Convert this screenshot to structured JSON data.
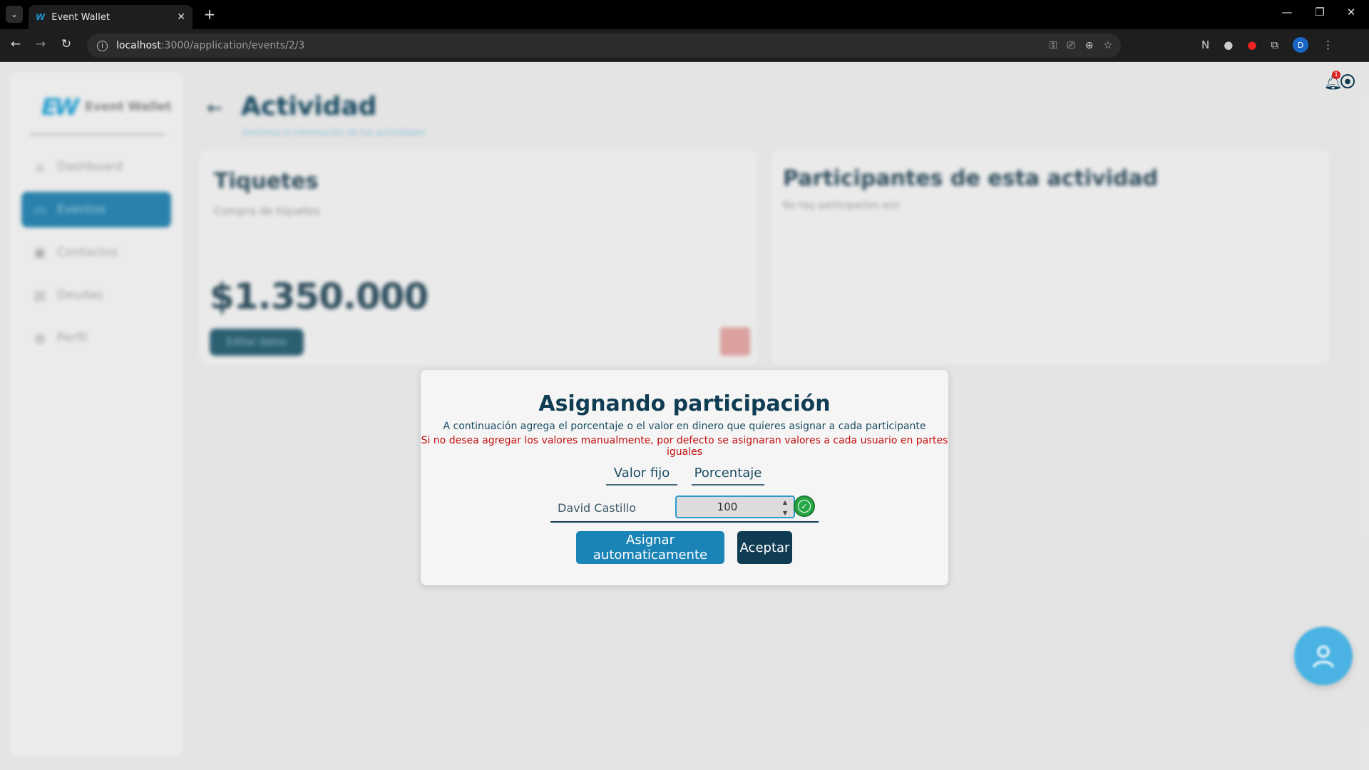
{
  "browser": {
    "tab_title": "Event Wallet",
    "tab_favicon": "W",
    "url_host": "localhost",
    "url_path": ":3000/application/events/2/3",
    "profile_initial": "D"
  },
  "sidebar": {
    "logo_mark": "EW",
    "logo_name": "Event Wallet",
    "items": [
      {
        "label": "Dashboard",
        "icon": "home-icon"
      },
      {
        "label": "Eventos",
        "icon": "calendar-icon"
      },
      {
        "label": "Contactos",
        "icon": "contacts-icon"
      },
      {
        "label": "Deudas",
        "icon": "receipt-icon"
      },
      {
        "label": "Perfil",
        "icon": "globe-icon"
      }
    ]
  },
  "header": {
    "title": "Actividad",
    "subtitle": "Gestiona la información de tus actividades",
    "notification_count": "1"
  },
  "ticket_card": {
    "title": "Tiquetes",
    "subtitle": "Compra de tiquetes",
    "amount": "$1.350.000",
    "edit_label": "Editar datos"
  },
  "participants_card": {
    "title": "Participantes de esta actividad",
    "empty_text": "No hay participantes aún"
  },
  "modal": {
    "title": "Asignando participación",
    "description": "A continuación agrega el porcentaje o el valor en dinero que quieres asignar a cada participante",
    "warning": "Si no desea agregar los valores manualmente, por defecto se asignaran valores a cada usuario en partes iguales",
    "mode_fixed_label": "Valor fijo",
    "mode_percent_label": "Porcentaje",
    "participants": [
      {
        "name": "David Castillo",
        "value": "100"
      }
    ],
    "auto_button": "Asignar automaticamente",
    "accept_button": "Aceptar"
  },
  "colors": {
    "primary": "#0f3c52",
    "accent": "#1b84b7",
    "warning": "#c40e0e",
    "success": "#28a745"
  }
}
